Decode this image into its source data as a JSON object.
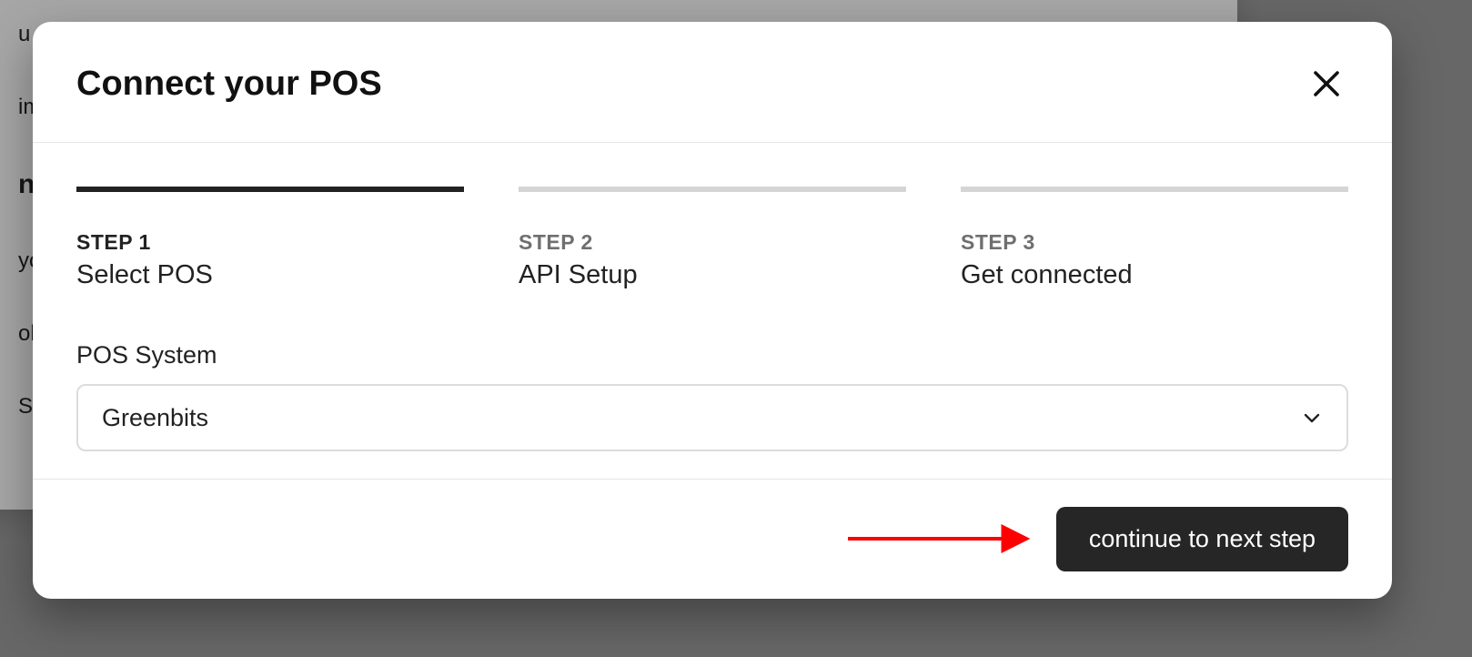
{
  "background": {
    "line1": "u c",
    "line2": "imp",
    "title": "nn",
    "line3": " yo",
    "line4": "ole",
    "line5": "S v"
  },
  "modal": {
    "title": "Connect your POS",
    "close_aria": "Close"
  },
  "steps": [
    {
      "kicker": "STEP 1",
      "title": "Select POS",
      "active": true
    },
    {
      "kicker": "STEP 2",
      "title": "API Setup",
      "active": false
    },
    {
      "kicker": "STEP 3",
      "title": "Get connected",
      "active": false
    }
  ],
  "field": {
    "label": "POS System",
    "value": "Greenbits"
  },
  "footer": {
    "continue_label": "continue to next step"
  },
  "annotation": {
    "arrow_color": "#ff0000"
  }
}
